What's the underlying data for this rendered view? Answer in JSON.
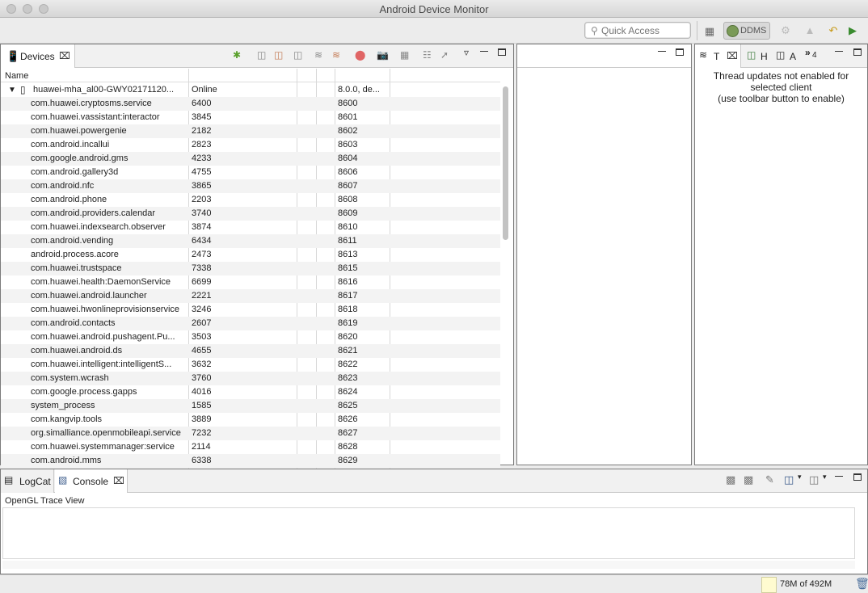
{
  "window": {
    "title": "Android Device Monitor"
  },
  "toolbar": {
    "quick_access_placeholder": "Quick Access",
    "perspective_label": "DDMS"
  },
  "devices": {
    "tab_label": "Devices",
    "columns": [
      "Name",
      "",
      "",
      "",
      ""
    ],
    "device": {
      "name": "huawei-mha_al00-GWY02171120...",
      "state": "Online",
      "version": "8.0.0, de..."
    },
    "processes": [
      {
        "name": "com.huawei.cryptosms.service",
        "pid": "6400",
        "port": "8600"
      },
      {
        "name": "com.huawei.vassistant:interactor",
        "pid": "3845",
        "port": "8601"
      },
      {
        "name": "com.huawei.powergenie",
        "pid": "2182",
        "port": "8602"
      },
      {
        "name": "com.android.incallui",
        "pid": "2823",
        "port": "8603"
      },
      {
        "name": "com.google.android.gms",
        "pid": "4233",
        "port": "8604"
      },
      {
        "name": "com.android.gallery3d",
        "pid": "4755",
        "port": "8606"
      },
      {
        "name": "com.android.nfc",
        "pid": "3865",
        "port": "8607"
      },
      {
        "name": "com.android.phone",
        "pid": "2203",
        "port": "8608"
      },
      {
        "name": "com.android.providers.calendar",
        "pid": "3740",
        "port": "8609"
      },
      {
        "name": "com.huawei.indexsearch.observer",
        "pid": "3874",
        "port": "8610"
      },
      {
        "name": "com.android.vending",
        "pid": "6434",
        "port": "8611"
      },
      {
        "name": "android.process.acore",
        "pid": "2473",
        "port": "8613"
      },
      {
        "name": "com.huawei.trustspace",
        "pid": "7338",
        "port": "8615"
      },
      {
        "name": "com.huawei.health:DaemonService",
        "pid": "6699",
        "port": "8616"
      },
      {
        "name": "com.huawei.android.launcher",
        "pid": "2221",
        "port": "8617"
      },
      {
        "name": "com.huawei.hwonlineprovisionservice",
        "pid": "3246",
        "port": "8618"
      },
      {
        "name": "com.android.contacts",
        "pid": "2607",
        "port": "8619"
      },
      {
        "name": "com.huawei.android.pushagent.Pu...",
        "pid": "3503",
        "port": "8620"
      },
      {
        "name": "com.huawei.android.ds",
        "pid": "4655",
        "port": "8621"
      },
      {
        "name": "com.huawei.intelligent:intelligentS...",
        "pid": "3632",
        "port": "8622"
      },
      {
        "name": "com.system.wcrash",
        "pid": "3760",
        "port": "8623"
      },
      {
        "name": "com.google.process.gapps",
        "pid": "4016",
        "port": "8624"
      },
      {
        "name": "system_process",
        "pid": "1585",
        "port": "8625"
      },
      {
        "name": "com.kangvip.tools",
        "pid": "3889",
        "port": "8626"
      },
      {
        "name": "org.simalliance.openmobileapi.service",
        "pid": "7232",
        "port": "8627"
      },
      {
        "name": "com.huawei.systemmanager:service",
        "pid": "2114",
        "port": "8628"
      },
      {
        "name": "com.android.mms",
        "pid": "6338",
        "port": "8629"
      }
    ]
  },
  "right_panel": {
    "tabs": [
      "T",
      "H",
      "A",
      "4"
    ],
    "message_line1": "Thread updates not enabled for",
    "message_line2": "selected client",
    "message_line3": "(use toolbar button to enable)"
  },
  "bottom_panel": {
    "tabs": [
      "LogCat",
      "Console"
    ],
    "console_title": "OpenGL Trace View"
  },
  "status": {
    "heap": "78M of 492M"
  }
}
